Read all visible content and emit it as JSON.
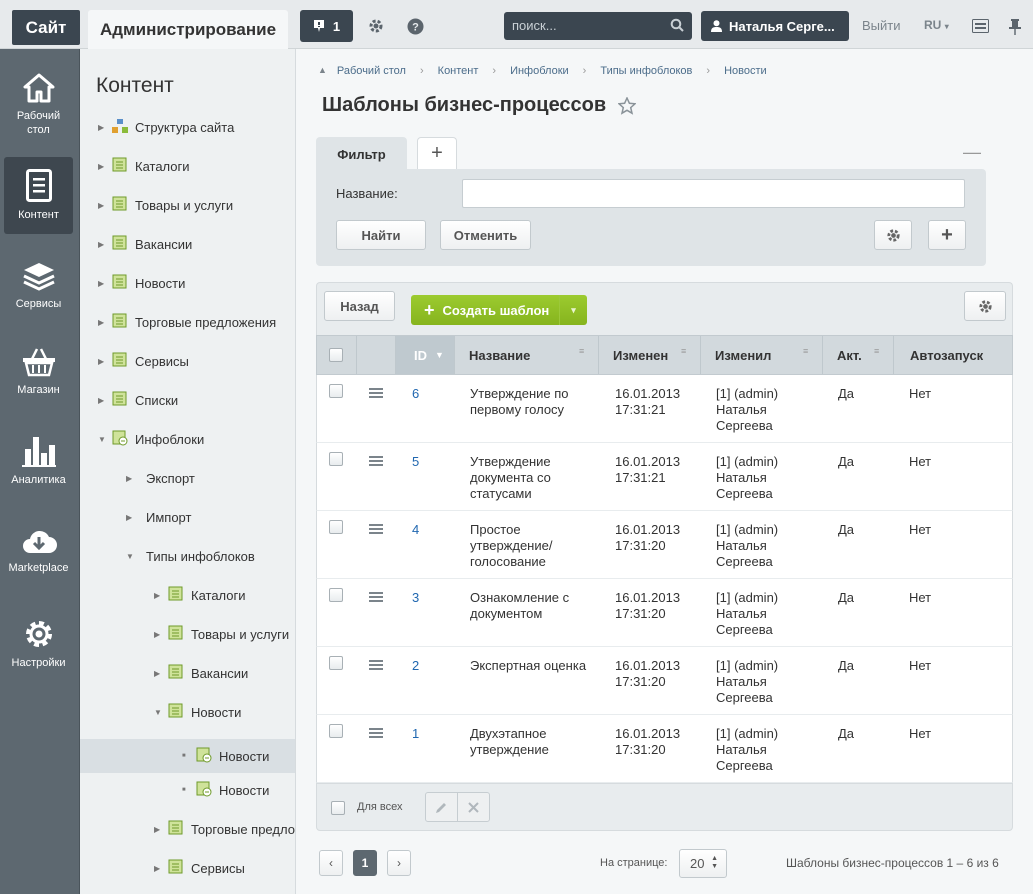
{
  "topbar": {
    "site": "Сайт",
    "admin": "Администрирование",
    "notif_count": "1",
    "search_placeholder": "поиск...",
    "user": "Наталья Серге...",
    "exit": "Выйти",
    "lang": "RU"
  },
  "rail": [
    {
      "label": "Рабочий стол",
      "icon": "home-icon"
    },
    {
      "label": "Контент",
      "icon": "document-icon"
    },
    {
      "label": "Сервисы",
      "icon": "layers-icon"
    },
    {
      "label": "Магазин",
      "icon": "basket-icon"
    },
    {
      "label": "Аналитика",
      "icon": "chart-icon"
    },
    {
      "label": "Marketplace",
      "icon": "cloud-download-icon"
    },
    {
      "label": "Настройки",
      "icon": "gear-icon"
    }
  ],
  "tree": {
    "title": "Контент",
    "items": [
      {
        "label": "Структура сайта"
      },
      {
        "label": "Каталоги"
      },
      {
        "label": "Товары и услуги"
      },
      {
        "label": "Вакансии"
      },
      {
        "label": "Новости"
      },
      {
        "label": "Торговые предложения"
      },
      {
        "label": "Сервисы"
      },
      {
        "label": "Списки"
      },
      {
        "label": "Инфоблоки"
      },
      {
        "label": "Экспорт"
      },
      {
        "label": "Импорт"
      },
      {
        "label": "Типы инфоблоков"
      },
      {
        "label": "Каталоги"
      },
      {
        "label": "Товары и услуги"
      },
      {
        "label": "Вакансии"
      },
      {
        "label": "Новости"
      },
      {
        "label": "Новости"
      },
      {
        "label": "Новости"
      },
      {
        "label": "Торговые предло"
      },
      {
        "label": "Сервисы"
      }
    ]
  },
  "breadcrumbs": [
    "Рабочий стол",
    "Контент",
    "Инфоблоки",
    "Типы инфоблоков",
    "Новости"
  ],
  "page_title": "Шаблоны бизнес-процессов",
  "filter": {
    "tab": "Фильтр",
    "name_label": "Название:",
    "find": "Найти",
    "cancel": "Отменить"
  },
  "grid": {
    "back": "Назад",
    "create": "Создать шаблон",
    "columns": {
      "id": "ID",
      "name": "Название",
      "changed": "Изменен",
      "changed_by": "Изменил",
      "active": "Акт.",
      "autorun": "Автозапуск"
    },
    "rows": [
      {
        "id": "6",
        "name": "Утверждение по первому голосу",
        "date": "16.01.2013",
        "time": "17:31:21",
        "by1": "[1] (admin)",
        "by2": "Наталья",
        "by3": "Сергеева",
        "active": "Да",
        "autorun": "Нет"
      },
      {
        "id": "5",
        "name": "Утверждение документа со статусами",
        "date": "16.01.2013",
        "time": "17:31:21",
        "by1": "[1] (admin)",
        "by2": "Наталья",
        "by3": "Сергеева",
        "active": "Да",
        "autorun": "Нет"
      },
      {
        "id": "4",
        "name": "Простое утверждение/ голосование",
        "date": "16.01.2013",
        "time": "17:31:20",
        "by1": "[1] (admin)",
        "by2": "Наталья",
        "by3": "Сергеева",
        "active": "Да",
        "autorun": "Нет"
      },
      {
        "id": "3",
        "name": "Ознакомление с документом",
        "date": "16.01.2013",
        "time": "17:31:20",
        "by1": "[1] (admin)",
        "by2": "Наталья",
        "by3": "Сергеева",
        "active": "Да",
        "autorun": "Нет"
      },
      {
        "id": "2",
        "name": "Экспертная оценка",
        "date": "16.01.2013",
        "time": "17:31:20",
        "by1": "[1] (admin)",
        "by2": "Наталья",
        "by3": "Сергеева",
        "active": "Да",
        "autorun": "Нет"
      },
      {
        "id": "1",
        "name": "Двухэтапное утверждение",
        "date": "16.01.2013",
        "time": "17:31:20",
        "by1": "[1] (admin)",
        "by2": "Наталья",
        "by3": "Сергеева",
        "active": "Да",
        "autorun": "Нет"
      }
    ],
    "for_all": "Для всех"
  },
  "pager": {
    "current": "1",
    "per_page_label": "На странице:",
    "per_page": "20",
    "summary": "Шаблоны бизнес-процессов 1 – 6 из 6"
  }
}
